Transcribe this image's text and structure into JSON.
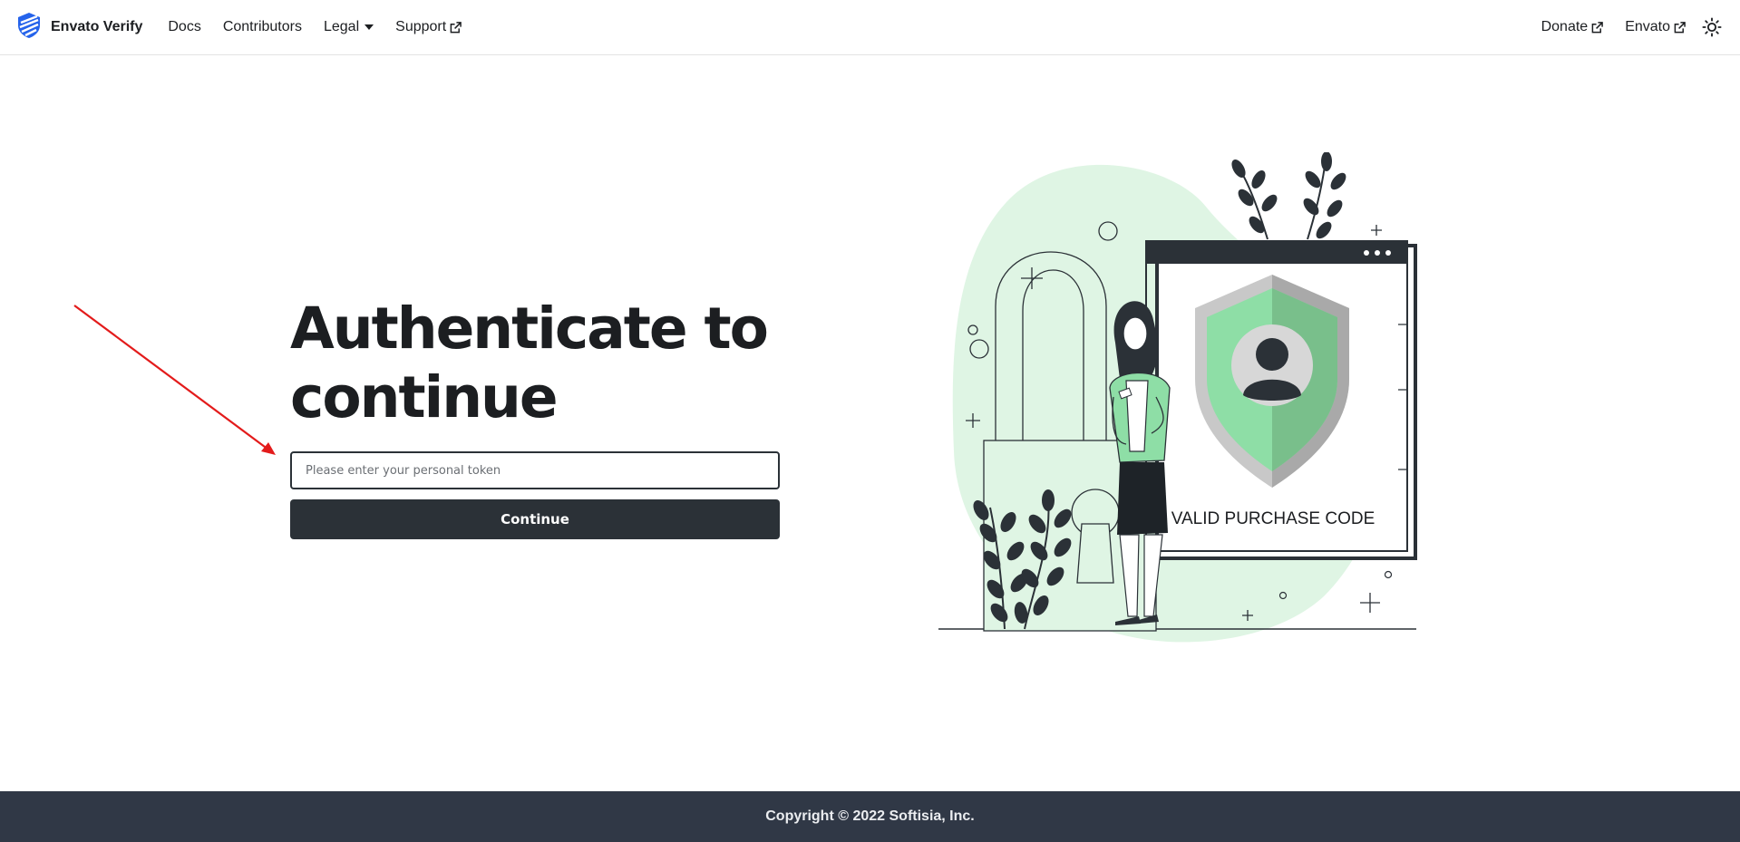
{
  "navbar": {
    "brand_title": "Envato Verify",
    "links": [
      {
        "label": "Docs"
      },
      {
        "label": "Contributors"
      },
      {
        "label": "Legal"
      },
      {
        "label": "Support"
      }
    ],
    "right_links": [
      {
        "label": "Donate"
      },
      {
        "label": "Envato"
      }
    ],
    "theme_icon": "sun-icon"
  },
  "main": {
    "title": "Authenticate to continue",
    "token_input": {
      "value": "",
      "placeholder": "Please enter your personal token"
    },
    "continue_label": "Continue",
    "illustration": {
      "caption": "VALID PURCHASE CODE"
    }
  },
  "annotation": {
    "arrow_color": "#e31b1b"
  },
  "footer": {
    "copyright": "Copyright © 2022 Softisia, Inc."
  },
  "colors": {
    "dark": "#2b3137",
    "footer_bg": "#303846",
    "accent_green": "#8edea6",
    "blob": "#dff5e4",
    "brand_blue": "#2563eb"
  }
}
